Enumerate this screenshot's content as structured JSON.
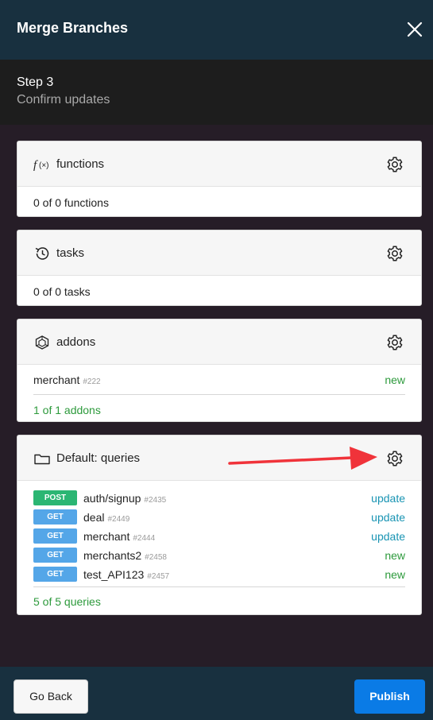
{
  "header": {
    "title": "Merge Branches"
  },
  "step": {
    "label": "Step 3",
    "subtitle": "Confirm updates"
  },
  "functions": {
    "title": "functions",
    "icon": "fx-icon",
    "summary": "0 of 0 functions"
  },
  "tasks": {
    "title": "tasks",
    "icon": "history-icon",
    "summary": "0 of 0 tasks"
  },
  "addons": {
    "title": "addons",
    "icon": "addon-icon",
    "items": [
      {
        "name": "merchant",
        "id": "#222",
        "status": "new"
      }
    ],
    "summary": "1 of 1 addons"
  },
  "queries": {
    "title": "Default: queries",
    "icon": "folder-icon",
    "items": [
      {
        "method": "POST",
        "name": "auth/signup",
        "id": "#2435",
        "status": "update"
      },
      {
        "method": "GET",
        "name": "deal",
        "id": "#2449",
        "status": "update"
      },
      {
        "method": "GET",
        "name": "merchant",
        "id": "#2444",
        "status": "update"
      },
      {
        "method": "GET",
        "name": "merchants2",
        "id": "#2458",
        "status": "new"
      },
      {
        "method": "GET",
        "name": "test_API123",
        "id": "#2457",
        "status": "new"
      }
    ],
    "summary": "5 of 5 queries"
  },
  "footer": {
    "back_label": "Go Back",
    "publish_label": "Publish"
  },
  "colors": {
    "header_bg": "#18303f",
    "publish": "#0a7be6",
    "new": "#2d9a3c",
    "update": "#1994b3",
    "post": "#2bb673",
    "get": "#54a6e8",
    "annotation_arrow": "#f0333a"
  }
}
